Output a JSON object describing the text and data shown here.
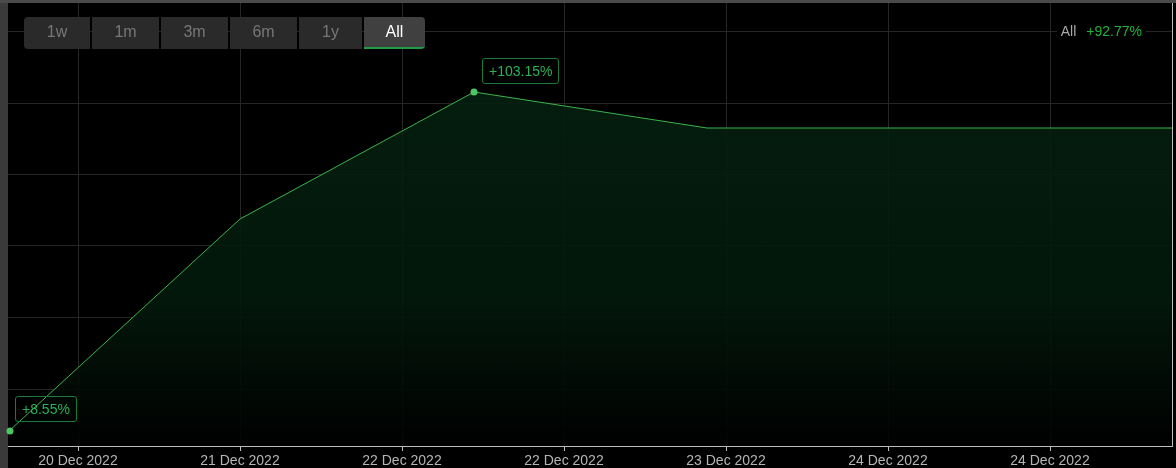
{
  "range_tabs": [
    {
      "label": "1w",
      "selected": false
    },
    {
      "label": "1m",
      "selected": false
    },
    {
      "label": "3m",
      "selected": false
    },
    {
      "label": "6m",
      "selected": false
    },
    {
      "label": "1y",
      "selected": false
    },
    {
      "label": "All",
      "selected": true
    }
  ],
  "summary": {
    "range": "All",
    "change": "+92.77%"
  },
  "point_labels": [
    "+103.15%",
    "+8.55%"
  ],
  "x_axis_labels": [
    "20 Dec 2022",
    "21 Dec 2022",
    "22 Dec 2022",
    "22 Dec 2022",
    "23 Dec 2022",
    "24 Dec 2022",
    "24 Dec 2022"
  ]
}
